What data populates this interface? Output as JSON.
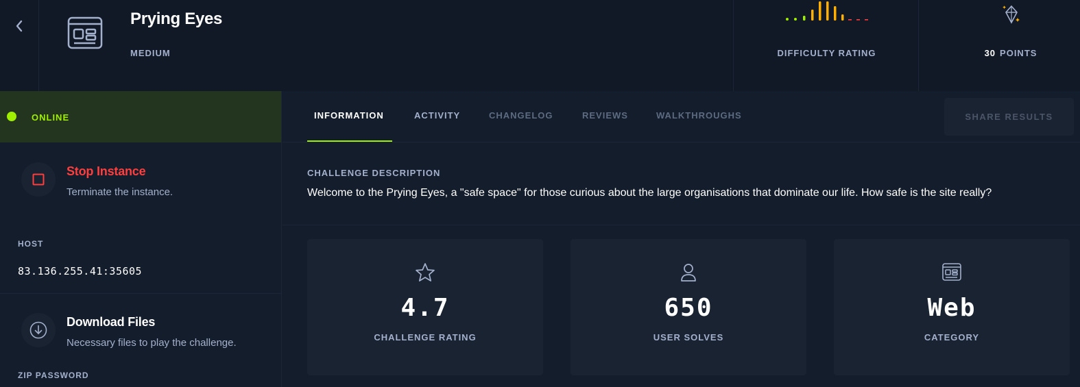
{
  "header": {
    "title": "Prying Eyes",
    "difficulty": "MEDIUM",
    "difficulty_rating_label": "DIFFICULTY RATING",
    "points_value": "30",
    "points_label": "POINTS"
  },
  "status": {
    "label": "ONLINE",
    "color": "#9fef00"
  },
  "stop_instance": {
    "title": "Stop Instance",
    "subtitle": "Terminate the instance."
  },
  "host": {
    "label": "HOST",
    "value": "83.136.255.41:35605"
  },
  "download": {
    "title": "Download Files",
    "subtitle": "Necessary files to play the challenge."
  },
  "zip": {
    "label": "ZIP PASSWORD"
  },
  "tabs": [
    {
      "label": "INFORMATION"
    },
    {
      "label": "ACTIVITY"
    },
    {
      "label": "CHANGELOG"
    },
    {
      "label": "REVIEWS"
    },
    {
      "label": "WALKTHROUGHS"
    }
  ],
  "share_button": "SHARE RESULTS",
  "description": {
    "label": "CHALLENGE DESCRIPTION",
    "text": "Welcome to the Prying Eyes, a \"safe space\" for those curious about the large organisations that dominate our life. How safe is the site really?"
  },
  "stats": [
    {
      "icon": "star-icon",
      "value": "4.7",
      "label": "CHALLENGE RATING"
    },
    {
      "icon": "user-icon",
      "value": "650",
      "label": "USER SOLVES"
    },
    {
      "icon": "web-window-icon",
      "value": "Web",
      "label": "CATEGORY"
    }
  ],
  "colors": {
    "accent": "#9fef00",
    "danger": "#ff3e3e",
    "background": "#141d2b",
    "panel": "#1a2332"
  }
}
